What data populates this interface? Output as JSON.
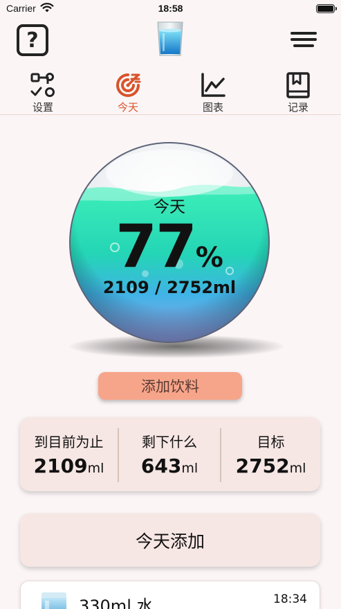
{
  "status_bar": {
    "carrier": "Carrier",
    "time": "18:58"
  },
  "header": {
    "help_glyph": "?",
    "logo_icon": "water-glass-icon",
    "menu_icon": "hamburger-menu-icon"
  },
  "tabs": [
    {
      "label": "设置",
      "icon": "settings-flow-icon",
      "active": false
    },
    {
      "label": "今天",
      "icon": "target-icon",
      "active": true
    },
    {
      "label": "图表",
      "icon": "line-chart-icon",
      "active": false
    },
    {
      "label": "记录",
      "icon": "bookmark-book-icon",
      "active": false
    }
  ],
  "progress": {
    "label": "今天",
    "percent": "77",
    "percent_sign": "%",
    "fraction": 0.77,
    "amount_text": "2109 / 2752ml"
  },
  "add_drink_label": "添加饮料",
  "stats": [
    {
      "label": "到目前为止",
      "value": "2109",
      "unit": "ml"
    },
    {
      "label": "剩下什么",
      "value": "643",
      "unit": "ml"
    },
    {
      "label": "目标",
      "value": "2752",
      "unit": "ml"
    }
  ],
  "today_added_label": "今天添加",
  "entries": [
    {
      "title": "330ml 水",
      "time": "18:34",
      "icon": "water-glass-icon"
    }
  ],
  "colors": {
    "accent": "#d9532a",
    "button": "#f7a58a",
    "card": "#f6e7e4",
    "water_top": "#3ff0b8",
    "water_bottom": "#4aa6ee"
  }
}
